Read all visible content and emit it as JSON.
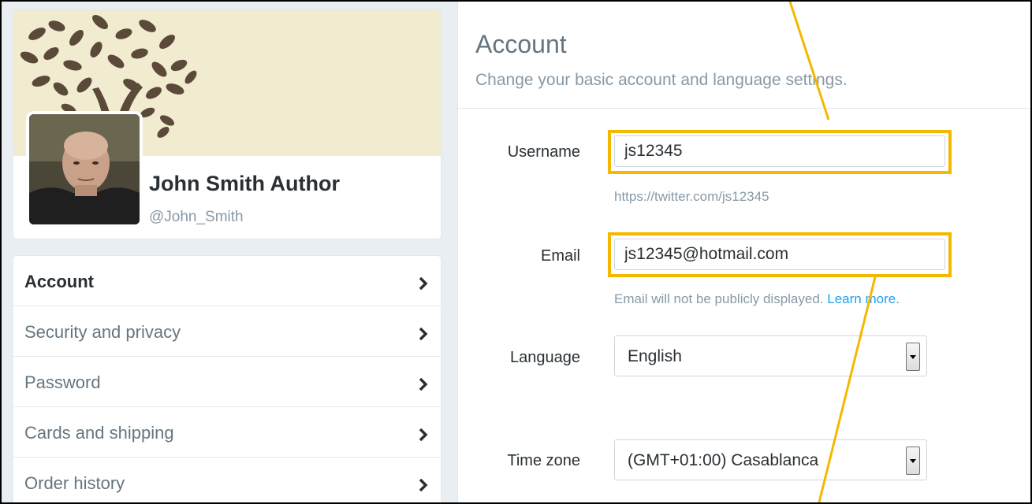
{
  "profile": {
    "name": "John Smith Author",
    "handle": "@John_Smith"
  },
  "sidebar": {
    "items": [
      {
        "label": "Account",
        "active": true
      },
      {
        "label": "Security and privacy",
        "active": false
      },
      {
        "label": "Password",
        "active": false
      },
      {
        "label": "Cards and shipping",
        "active": false
      },
      {
        "label": "Order history",
        "active": false
      }
    ]
  },
  "header": {
    "title": "Account",
    "subtitle": "Change your basic account and language settings."
  },
  "form": {
    "username": {
      "label": "Username",
      "value": "js12345",
      "url_hint": "https://twitter.com/js12345"
    },
    "email": {
      "label": "Email",
      "value": "js12345@hotmail.com",
      "note": "Email will not be publicly displayed.",
      "learn_more": "Learn more."
    },
    "language": {
      "label": "Language",
      "value": "English"
    },
    "timezone": {
      "label": "Time zone",
      "value": "(GMT+01:00) Casablanca"
    }
  },
  "colors": {
    "highlight": "#f5b800",
    "link": "#1da1f2",
    "banner": "#f1ebd0",
    "tree": "#5b4a3a"
  }
}
